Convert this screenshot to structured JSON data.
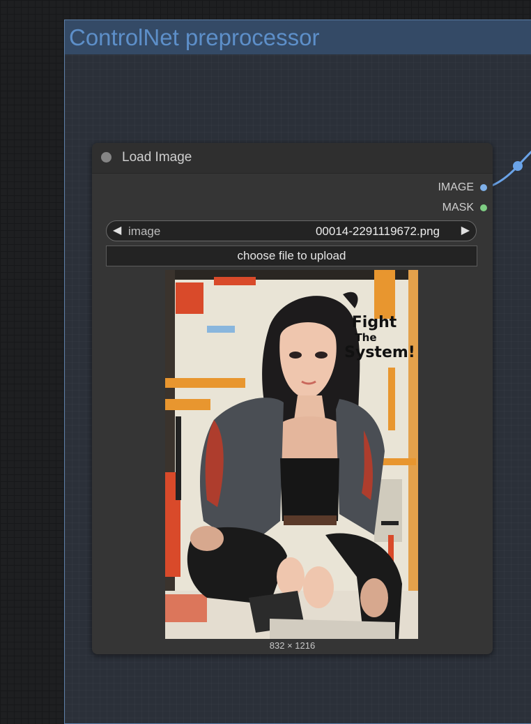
{
  "group": {
    "title": "ControlNet preprocessor"
  },
  "node": {
    "title": "Load Image",
    "outputs": [
      {
        "label": "IMAGE",
        "color": "#7fb0e8"
      },
      {
        "label": "MASK",
        "color": "#7fce84"
      }
    ],
    "widget": {
      "label": "image",
      "value": "00014-2291119672.png"
    },
    "upload_label": "choose file to upload",
    "preview": {
      "poster_text": [
        "Fight",
        "The",
        "System!"
      ],
      "dimensions": "832 × 1216"
    }
  },
  "colors": {
    "wire": "#6aa3e8",
    "group_title": "#5d8fc9",
    "group_bar": "#344a66"
  }
}
